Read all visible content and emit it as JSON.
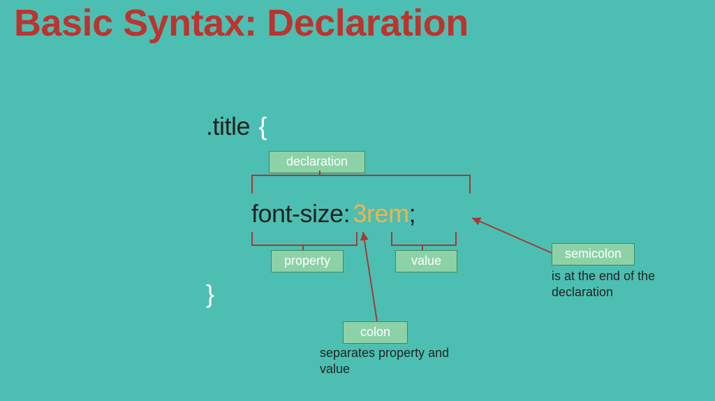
{
  "heading": "Basic Syntax: Declaration",
  "code": {
    "selector": ".title",
    "brace_open": "{",
    "property": "font-size",
    "colon": ":",
    "value": "3rem",
    "semicolon": ";",
    "brace_close": "}"
  },
  "labels": {
    "declaration": "declaration",
    "property": "property",
    "value": "value",
    "colon": "colon",
    "semicolon": "semicolon"
  },
  "annotations": {
    "colon_note": "separates property and value",
    "semicolon_note": "is at the end of the declaration"
  },
  "colors": {
    "bg": "#4cbfb2",
    "heading": "#bd332e",
    "label_fill": "#8dd2a7",
    "label_border": "#3c8a5f",
    "value": "#f5b24a",
    "bracket": "#a33a35"
  }
}
